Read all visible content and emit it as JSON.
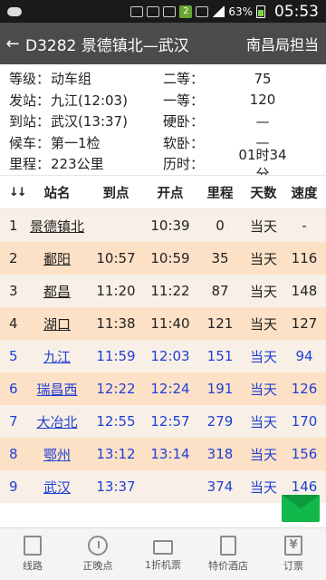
{
  "status_bar": {
    "battery": "63%",
    "time": "05:53",
    "badge": "2"
  },
  "appbar": {
    "back_icon": "←",
    "title": "D3282 景德镇北—武汉",
    "right_label": "南昌局担当"
  },
  "info": {
    "rows": [
      {
        "label": "等级：",
        "value": "动车组",
        "label2": "二等：",
        "value2": "75"
      },
      {
        "label": "发站：",
        "value": "九江(12:03)",
        "label2": "一等：",
        "value2": "120"
      },
      {
        "label": "到站：",
        "value": "武汉(13:37)",
        "label2": "硬卧：",
        "value2": "—"
      },
      {
        "label": "候车：",
        "value": "第一1检",
        "label2": "软卧：",
        "value2": "—"
      },
      {
        "label": "里程：",
        "value": "223公里",
        "label2": "历时：",
        "value2": "01时34分"
      }
    ]
  },
  "table": {
    "headers": {
      "sort": "↓↓",
      "name": "站名",
      "arrive": "到点",
      "depart": "开点",
      "distance": "里程",
      "day": "天数",
      "speed": "速度"
    },
    "rows": [
      {
        "idx": "1",
        "name": "景德镇北",
        "arrive": "",
        "depart": "10:39",
        "distance": "0",
        "day": "当天",
        "speed": "-"
      },
      {
        "idx": "2",
        "name": "鄱阳",
        "arrive": "10:57",
        "depart": "10:59",
        "distance": "35",
        "day": "当天",
        "speed": "116"
      },
      {
        "idx": "3",
        "name": "都昌",
        "arrive": "11:20",
        "depart": "11:22",
        "distance": "87",
        "day": "当天",
        "speed": "148"
      },
      {
        "idx": "4",
        "name": "湖口",
        "arrive": "11:38",
        "depart": "11:40",
        "distance": "121",
        "day": "当天",
        "speed": "127"
      },
      {
        "idx": "5",
        "name": "九江",
        "arrive": "11:59",
        "depart": "12:03",
        "distance": "151",
        "day": "当天",
        "speed": "94"
      },
      {
        "idx": "6",
        "name": "瑞昌西",
        "arrive": "12:22",
        "depart": "12:24",
        "distance": "191",
        "day": "当天",
        "speed": "126"
      },
      {
        "idx": "7",
        "name": "大冶北",
        "arrive": "12:55",
        "depart": "12:57",
        "distance": "279",
        "day": "当天",
        "speed": "170"
      },
      {
        "idx": "8",
        "name": "鄂州",
        "arrive": "13:12",
        "depart": "13:14",
        "distance": "318",
        "day": "当天",
        "speed": "156"
      },
      {
        "idx": "9",
        "name": "武汉",
        "arrive": "13:37",
        "depart": "",
        "distance": "374",
        "day": "当天",
        "speed": "146"
      }
    ]
  },
  "bottom_nav": {
    "items": [
      {
        "label": "线路",
        "icon": "map-icon"
      },
      {
        "label": "正晚点",
        "icon": "clock-icon"
      },
      {
        "label": "1折机票",
        "icon": "ticket-icon"
      },
      {
        "label": "特价酒店",
        "icon": "hotel-icon"
      },
      {
        "label": "订票",
        "icon": "yen-icon",
        "glyph": "¥"
      }
    ]
  },
  "colors": {
    "appbar_bg": "#4b4b4b",
    "row_odd": "#f8f0e6",
    "row_even": "#fde1c7",
    "highlight_text": "#1f3fd6",
    "fab_green": "#12b84a"
  }
}
